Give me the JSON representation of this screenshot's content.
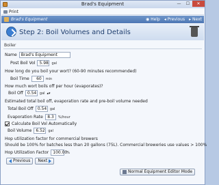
{
  "window": {
    "title": "Brad's Equipment",
    "controls": {
      "minimize": "—",
      "maximize": "☐",
      "close": "✕"
    }
  },
  "menu": {
    "print": "Print"
  },
  "apptab": {
    "label": "Brad's Equipment",
    "help": "Help",
    "previous": "Previous",
    "next": "Next"
  },
  "step": {
    "title": "Step 2: Boil Volumes and Details"
  },
  "section": "Boiler",
  "fields": {
    "name_label": "Name",
    "name_value": "Brad's Equipment",
    "post_boil_label": "Post Boil Vol",
    "post_boil_value": "5.98",
    "post_boil_unit": "gal",
    "q_boil_time": "How long do you boil your wort? (60-90 minutes recommended)",
    "boil_time_label": "Boil Time",
    "boil_time_value": "60",
    "boil_time_unit": "min",
    "q_boil_off": "How much wort boils off per hour (evaporates)?",
    "boil_off_label": "Boil Off",
    "boil_off_value": "0.54",
    "boil_off_unit": "gal",
    "q_estimated": "Estimated total boil off, evaporation rate and pre-boil volume needed",
    "total_boil_off_label": "Total Boil Off",
    "total_boil_off_value": "0.54",
    "total_boil_off_unit": "gal",
    "evap_rate_label": "Evaporation Rate",
    "evap_rate_value": "8.3",
    "evap_rate_unit": "%/hour",
    "calc_label": "Calculate Boil Vol Automatically",
    "boil_volume_label": "Boil Volume",
    "boil_volume_value": "6.52",
    "boil_volume_unit": "gal",
    "hop_title": "Hop utilization factor for commercial brewers",
    "hop_desc": "Should be 100% for batches less than 20 gallons (75L).  Commercial breweries use values > 100%",
    "hop_factor_label": "Hop Utilization Factor",
    "hop_factor_value": "100.00",
    "hop_factor_unit": "%"
  },
  "buttons": {
    "previous": "Previous",
    "next": "Next",
    "normal_editor": "Normal Equipment Editor Mode"
  }
}
